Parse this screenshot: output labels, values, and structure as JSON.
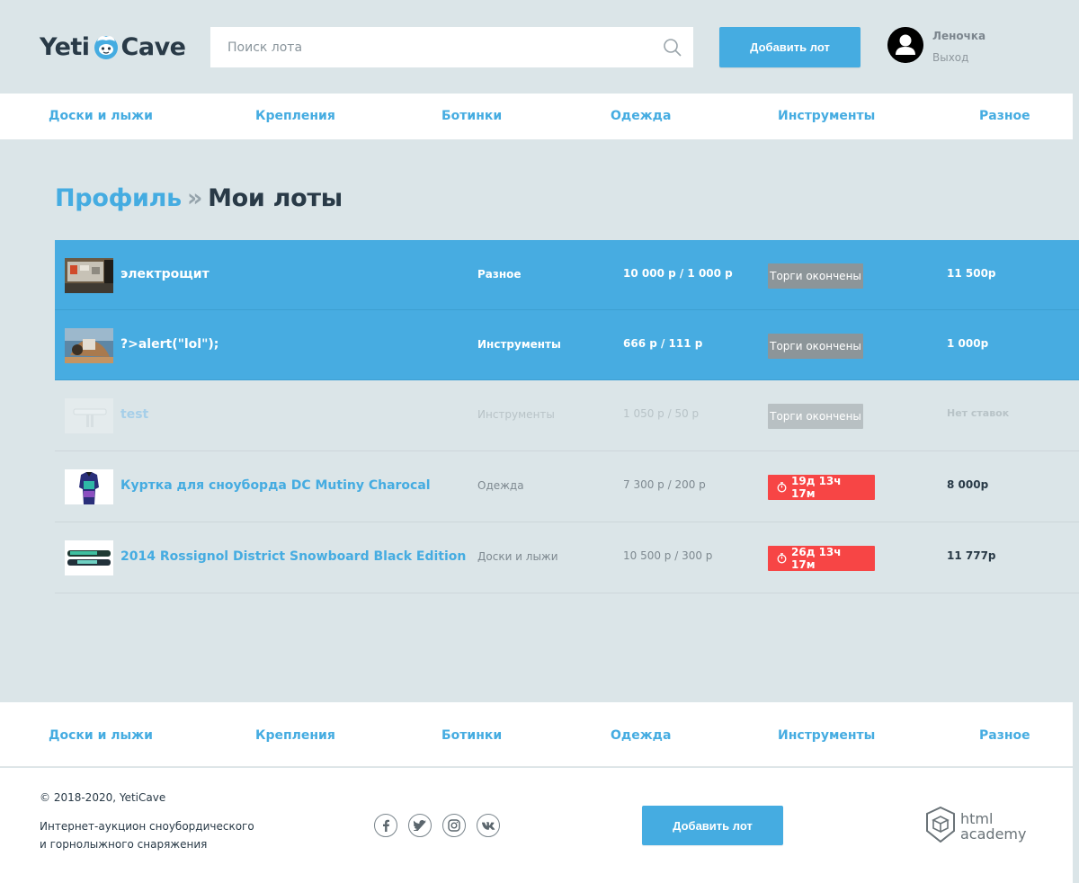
{
  "header": {
    "logo_left": "Yeti",
    "logo_right": "Cave",
    "search_placeholder": "Поиск лота",
    "add_lot_label": "Добавить лот",
    "user_name": "Леночка",
    "logout_label": "Выход"
  },
  "nav": {
    "items": [
      "Доски и лыжи",
      "Крепления",
      "Ботинки",
      "Одежда",
      "Инструменты",
      "Разное"
    ]
  },
  "breadcrumb": {
    "parent": "Профиль",
    "separator": "»",
    "current": "Мои лоты"
  },
  "lots": [
    {
      "title": "электрощит",
      "category": "Разное",
      "price": "10 000 р / 1 000 р",
      "timer": "Торги окончены",
      "bid": "11 500р",
      "state": "won"
    },
    {
      "title": "?>alert(\"lol\");",
      "category": "Инструменты",
      "price": "666 р / 111 р",
      "timer": "Торги окончены",
      "bid": "1 000р",
      "state": "won"
    },
    {
      "title": "test",
      "category": "Инструменты",
      "price": "1 050 р / 50 р",
      "timer": "Торги окончены",
      "bid": "Нет ставок",
      "state": "ended"
    },
    {
      "title": "Куртка для сноуборда DC Mutiny Charocal",
      "category": "Одежда",
      "price": "7 300 р / 200 р",
      "timer": "19д 13ч 17м",
      "bid": "8 000р",
      "state": "active"
    },
    {
      "title": "2014 Rossignol District Snowboard Black Edition",
      "category": "Доски и лыжи",
      "price": "10 500 р / 300 р",
      "timer": "26д 13ч 17м",
      "bid": "11 777р",
      "state": "active"
    }
  ],
  "footer": {
    "copyright": "© 2018-2020, YetiCave",
    "about_line1": "Интернет-аукцион сноубордического",
    "about_line2": "и горнолыжного снаряжения",
    "add_lot_label": "Добавить лот",
    "academy_line1": "html",
    "academy_line2": "academy",
    "socials": [
      "facebook-icon",
      "twitter-icon",
      "instagram-icon",
      "vk-icon"
    ]
  },
  "colors": {
    "accent": "#45ace1",
    "background": "#dbe5e8",
    "text": "#293a47",
    "timer_hot": "#f74545",
    "timer_ended": "#8c9599"
  }
}
